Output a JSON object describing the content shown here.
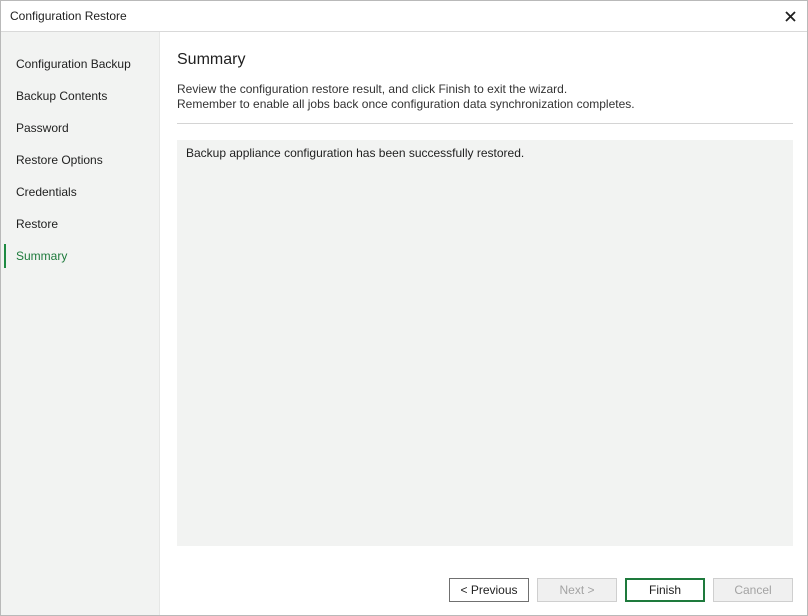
{
  "window": {
    "title": "Configuration Restore"
  },
  "sidebar": {
    "items": [
      {
        "label": "Configuration Backup"
      },
      {
        "label": "Backup Contents"
      },
      {
        "label": "Password"
      },
      {
        "label": "Restore Options"
      },
      {
        "label": "Credentials"
      },
      {
        "label": "Restore"
      },
      {
        "label": "Summary",
        "active": true
      }
    ]
  },
  "main": {
    "title": "Summary",
    "description": [
      "Review the configuration restore result, and click Finish to exit the wizard.",
      "Remember to enable all jobs back once configuration data synchronization completes."
    ],
    "result_text": "Backup appliance configuration has been successfully restored."
  },
  "buttons": {
    "previous": "< Previous",
    "next": "Next >",
    "finish": "Finish",
    "cancel": "Cancel"
  },
  "colors": {
    "accent": "#1e7a3c",
    "sidebar_bg": "#f2f3f2",
    "panel_bg": "#f2f3f2"
  },
  "icons": {
    "close": "close-icon"
  }
}
